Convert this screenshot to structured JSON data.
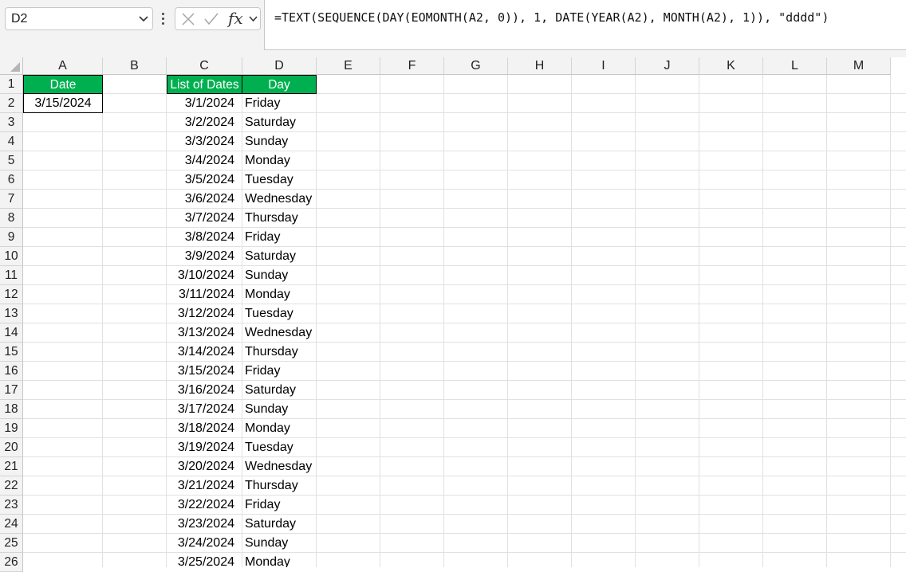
{
  "formula_bar": {
    "name_box": "D2",
    "fx_label": "fx",
    "formula": "=TEXT(SEQUENCE(DAY(EOMONTH(A2, 0)), 1, DATE(YEAR(A2), MONTH(A2), 1)), \"dddd\")",
    "icons": [
      "chevron-down-icon",
      "more-options-icon",
      "cancel-icon",
      "enter-icon",
      "function-icon"
    ]
  },
  "columns": [
    "A",
    "B",
    "C",
    "D",
    "E",
    "F",
    "G",
    "H",
    "I",
    "J",
    "K",
    "L",
    "M"
  ],
  "rows": [
    "1",
    "2",
    "3",
    "4",
    "5",
    "6",
    "7",
    "8",
    "9",
    "10",
    "11",
    "12",
    "13",
    "14",
    "15",
    "16",
    "17",
    "18",
    "19",
    "20",
    "21",
    "22",
    "23",
    "24",
    "25",
    "26"
  ],
  "sheet": {
    "header_fill": "#00b050",
    "A1": "Date",
    "A2": "3/15/2024",
    "C1": "List of Dates",
    "D1": "Day",
    "dates": [
      "3/1/2024",
      "3/2/2024",
      "3/3/2024",
      "3/4/2024",
      "3/5/2024",
      "3/6/2024",
      "3/7/2024",
      "3/8/2024",
      "3/9/2024",
      "3/10/2024",
      "3/11/2024",
      "3/12/2024",
      "3/13/2024",
      "3/14/2024",
      "3/15/2024",
      "3/16/2024",
      "3/17/2024",
      "3/18/2024",
      "3/19/2024",
      "3/20/2024",
      "3/21/2024",
      "3/22/2024",
      "3/23/2024",
      "3/24/2024",
      "3/25/2024"
    ],
    "days": [
      "Friday",
      "Saturday",
      "Sunday",
      "Monday",
      "Tuesday",
      "Wednesday",
      "Thursday",
      "Friday",
      "Saturday",
      "Sunday",
      "Monday",
      "Tuesday",
      "Wednesday",
      "Thursday",
      "Friday",
      "Saturday",
      "Sunday",
      "Monday",
      "Tuesday",
      "Wednesday",
      "Thursday",
      "Friday",
      "Saturday",
      "Sunday",
      "Monday"
    ]
  }
}
